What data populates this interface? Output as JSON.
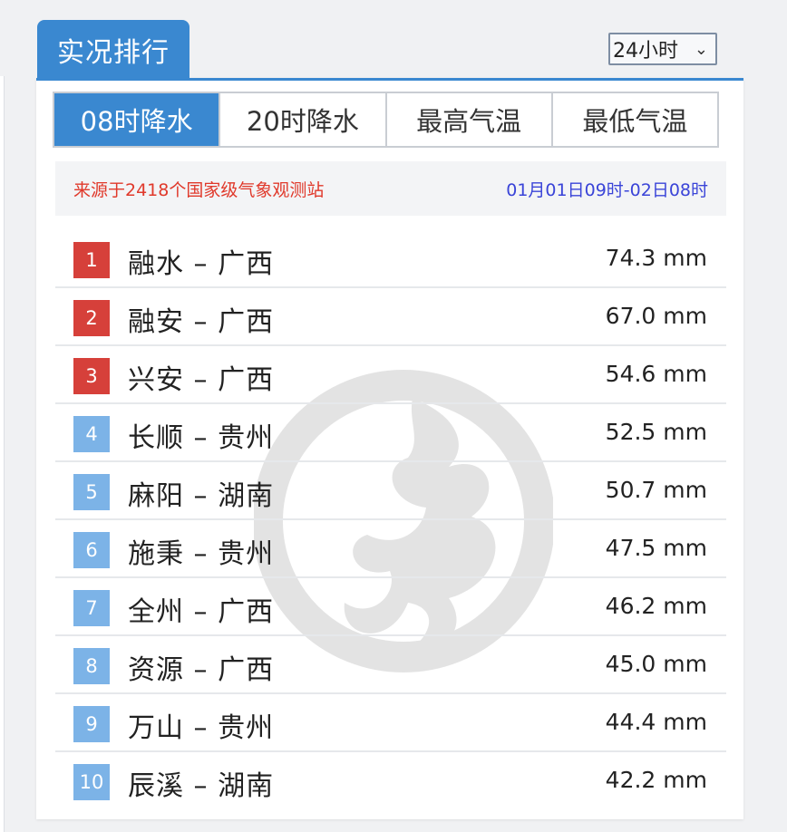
{
  "header": {
    "title": "实况排行",
    "period_select": {
      "selected": "24小时",
      "options": [
        "24小时"
      ]
    }
  },
  "tabs": [
    {
      "label": "08时降水",
      "active": true
    },
    {
      "label": "20时降水",
      "active": false
    },
    {
      "label": "最高气温",
      "active": false
    },
    {
      "label": "最低气温",
      "active": false
    }
  ],
  "info": {
    "source": "来源于2418个国家级气象观测站",
    "time_range": "01月01日09时-02日08时"
  },
  "ranking": [
    {
      "rank": "1",
      "station": "融水 – 广西",
      "value": "74.3 mm"
    },
    {
      "rank": "2",
      "station": "融安 – 广西",
      "value": "67.0 mm"
    },
    {
      "rank": "3",
      "station": "兴安 – 广西",
      "value": "54.6 mm"
    },
    {
      "rank": "4",
      "station": "长顺 – 贵州",
      "value": "52.5 mm"
    },
    {
      "rank": "5",
      "station": "麻阳 – 湖南",
      "value": "50.7 mm"
    },
    {
      "rank": "6",
      "station": "施秉 – 贵州",
      "value": "47.5 mm"
    },
    {
      "rank": "7",
      "station": "全州 – 广西",
      "value": "46.2 mm"
    },
    {
      "rank": "8",
      "station": "资源 – 广西",
      "value": "45.0 mm"
    },
    {
      "rank": "9",
      "station": "万山 – 贵州",
      "value": "44.4 mm"
    },
    {
      "rank": "10",
      "station": "辰溪 – 湖南",
      "value": "42.2 mm"
    }
  ],
  "colors": {
    "accent": "#3a88d0",
    "top_rank": "#d6403a",
    "other_rank": "#7cb3e7",
    "source_text": "#e0392b",
    "time_text": "#3a44d8"
  },
  "icons": {
    "select_chevron": "chevron-down-icon",
    "watermark": "weather-logo-watermark"
  },
  "glyphs": {
    "chevron": "⌄"
  }
}
